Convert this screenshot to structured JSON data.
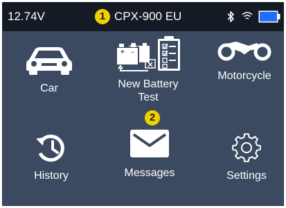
{
  "status_bar": {
    "voltage": "12.74V",
    "device_name": "CPX-900 EU",
    "icons": [
      "bluetooth-icon",
      "wifi-icon",
      "battery-icon"
    ],
    "battery_level": 1.0
  },
  "callouts": {
    "first": "1",
    "second": "2"
  },
  "menu": {
    "car": "Car",
    "new_battery_test_line1": "New Battery",
    "new_battery_test_line2": "Test",
    "motorcycle": "Motorcycle",
    "history": "History",
    "messages": "Messages",
    "settings": "Settings"
  },
  "colors": {
    "background": "#3b4a60",
    "status_bar": "#151b25",
    "callout": "#f2d000",
    "battery_fill": "#1e6fff"
  }
}
